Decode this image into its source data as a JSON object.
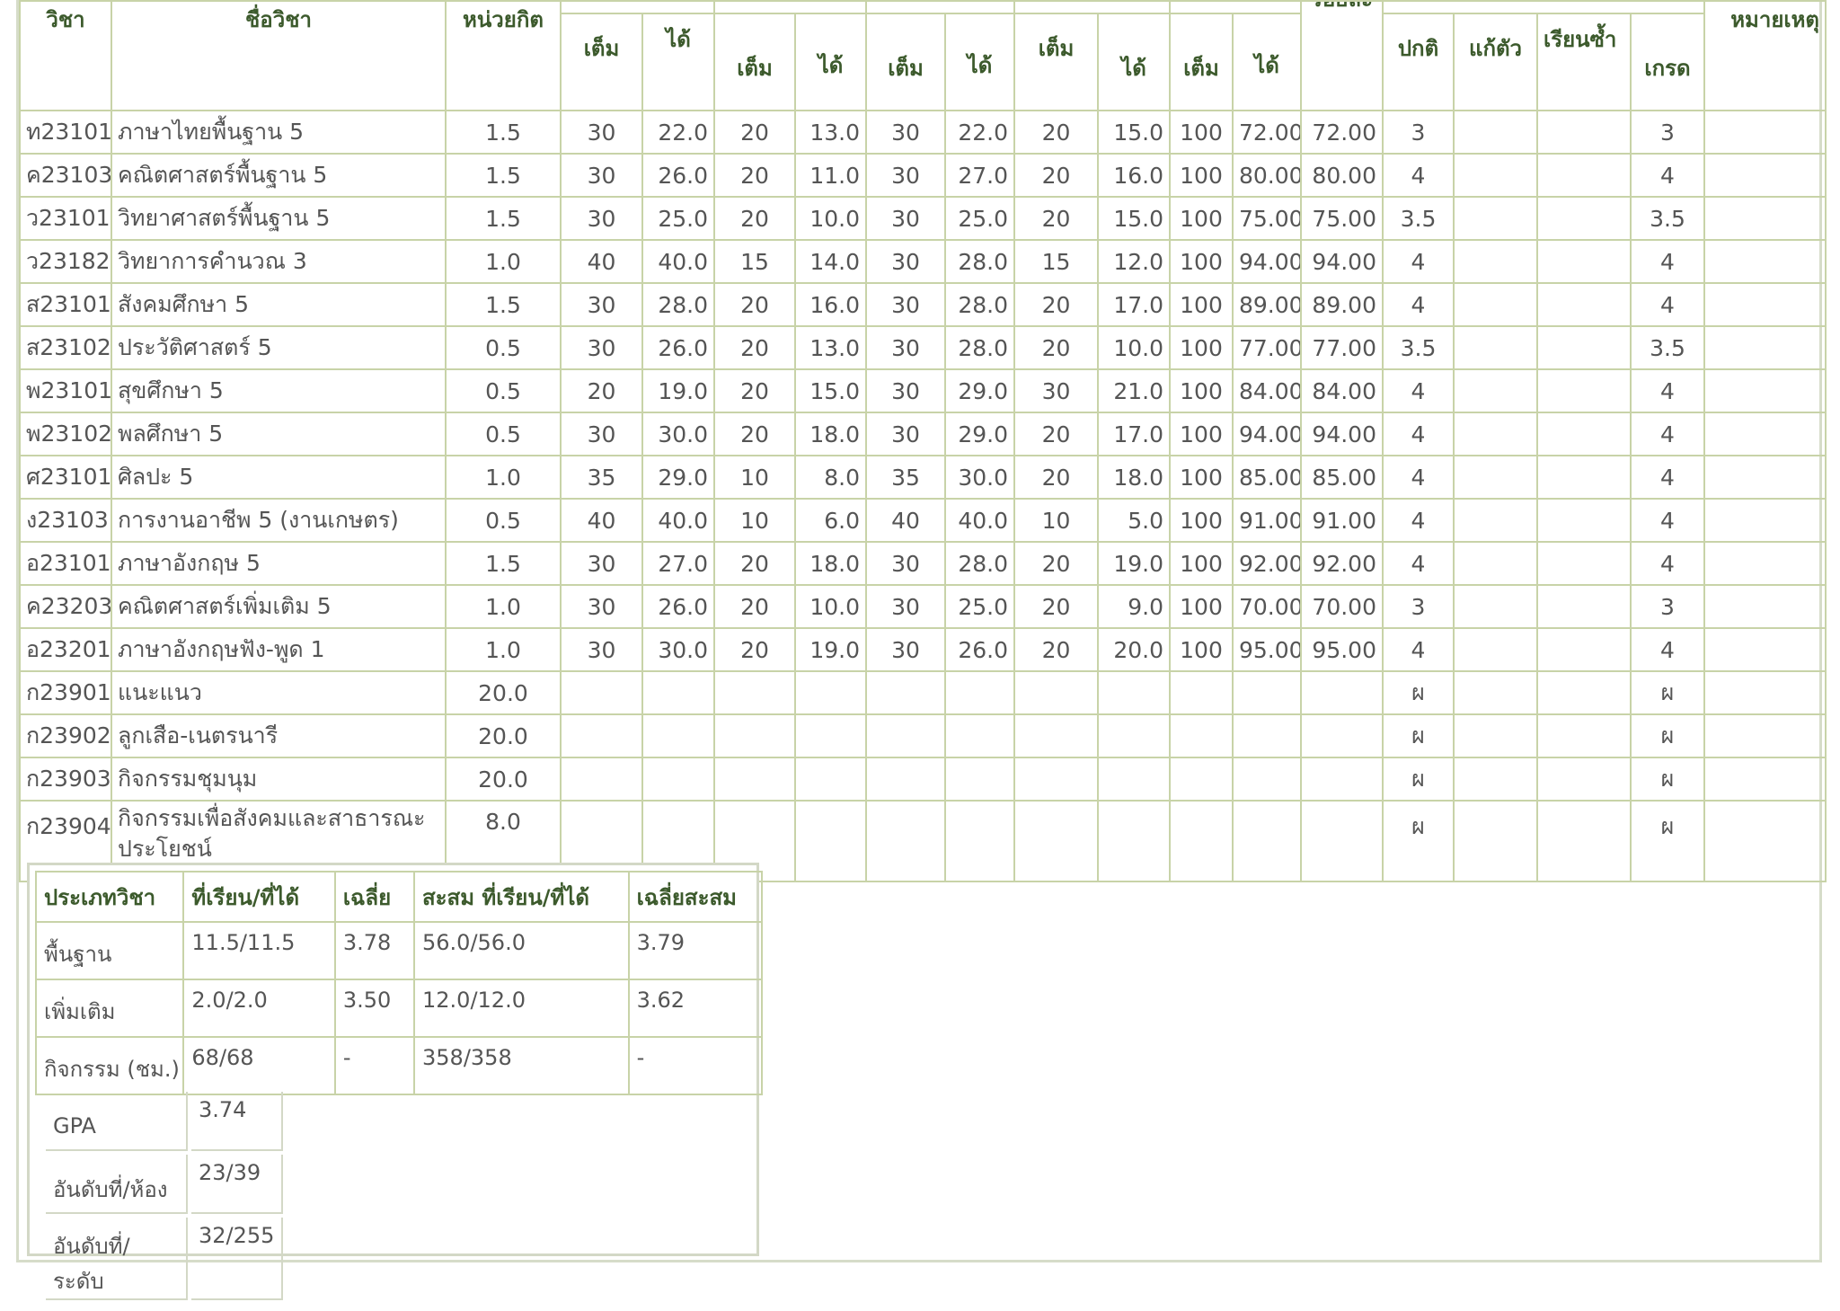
{
  "headers": {
    "code": "วิชา",
    "name": "ชื่อวิชา",
    "credit": "หน่วยกิต",
    "full": "เต็ม",
    "got": "ได้",
    "percent": "ร้อยละ",
    "normal": "ปกติ",
    "fix": "แก้ตัว",
    "repeat": "เรียนซ้ำ",
    "grade": "เกรด",
    "note": "หมายเหตุ"
  },
  "rows": [
    {
      "code": "ท23101",
      "name": "ภาษาไทยพื้นฐาน 5",
      "credit": "1.5",
      "s": [
        "30",
        "22.0",
        "20",
        "13.0",
        "30",
        "22.0",
        "20",
        "15.0",
        "100",
        "72.00"
      ],
      "percent": "72.00",
      "normal": "3",
      "grade": "3"
    },
    {
      "code": "ค23103",
      "name": "คณิตศาสตร์พื้นฐาน 5",
      "credit": "1.5",
      "s": [
        "30",
        "26.0",
        "20",
        "11.0",
        "30",
        "27.0",
        "20",
        "16.0",
        "100",
        "80.00"
      ],
      "percent": "80.00",
      "normal": "4",
      "grade": "4"
    },
    {
      "code": "ว23101",
      "name": "วิทยาศาสตร์พื้นฐาน 5",
      "credit": "1.5",
      "s": [
        "30",
        "25.0",
        "20",
        "10.0",
        "30",
        "25.0",
        "20",
        "15.0",
        "100",
        "75.00"
      ],
      "percent": "75.00",
      "normal": "3.5",
      "grade": "3.5"
    },
    {
      "code": "ว23182",
      "name": "วิทยาการคำนวณ 3",
      "credit": "1.0",
      "s": [
        "40",
        "40.0",
        "15",
        "14.0",
        "30",
        "28.0",
        "15",
        "12.0",
        "100",
        "94.00"
      ],
      "percent": "94.00",
      "normal": "4",
      "grade": "4"
    },
    {
      "code": "ส23101",
      "name": "สังคมศึกษา 5",
      "credit": "1.5",
      "s": [
        "30",
        "28.0",
        "20",
        "16.0",
        "30",
        "28.0",
        "20",
        "17.0",
        "100",
        "89.00"
      ],
      "percent": "89.00",
      "normal": "4",
      "grade": "4"
    },
    {
      "code": "ส23102",
      "name": "ประวัติศาสตร์ 5",
      "credit": "0.5",
      "s": [
        "30",
        "26.0",
        "20",
        "13.0",
        "30",
        "28.0",
        "20",
        "10.0",
        "100",
        "77.00"
      ],
      "percent": "77.00",
      "normal": "3.5",
      "grade": "3.5"
    },
    {
      "code": "พ23101",
      "name": "สุขศึกษา 5",
      "credit": "0.5",
      "s": [
        "20",
        "19.0",
        "20",
        "15.0",
        "30",
        "29.0",
        "30",
        "21.0",
        "100",
        "84.00"
      ],
      "percent": "84.00",
      "normal": "4",
      "grade": "4"
    },
    {
      "code": "พ23102",
      "name": "พลศึกษา 5",
      "credit": "0.5",
      "s": [
        "30",
        "30.0",
        "20",
        "18.0",
        "30",
        "29.0",
        "20",
        "17.0",
        "100",
        "94.00"
      ],
      "percent": "94.00",
      "normal": "4",
      "grade": "4"
    },
    {
      "code": "ศ23101",
      "name": "ศิลปะ 5",
      "credit": "1.0",
      "s": [
        "35",
        "29.0",
        "10",
        "8.0",
        "35",
        "30.0",
        "20",
        "18.0",
        "100",
        "85.00"
      ],
      "percent": "85.00",
      "normal": "4",
      "grade": "4"
    },
    {
      "code": "ง23103",
      "name": "การงานอาชีพ 5 (งานเกษตร)",
      "credit": "0.5",
      "s": [
        "40",
        "40.0",
        "10",
        "6.0",
        "40",
        "40.0",
        "10",
        "5.0",
        "100",
        "91.00"
      ],
      "percent": "91.00",
      "normal": "4",
      "grade": "4"
    },
    {
      "code": "อ23101",
      "name": "ภาษาอังกฤษ 5",
      "credit": "1.5",
      "s": [
        "30",
        "27.0",
        "20",
        "18.0",
        "30",
        "28.0",
        "20",
        "19.0",
        "100",
        "92.00"
      ],
      "percent": "92.00",
      "normal": "4",
      "grade": "4"
    },
    {
      "code": "ค23203",
      "name": "คณิตศาสตร์เพิ่มเติม 5",
      "credit": "1.0",
      "s": [
        "30",
        "26.0",
        "20",
        "10.0",
        "30",
        "25.0",
        "20",
        "9.0",
        "100",
        "70.00"
      ],
      "percent": "70.00",
      "normal": "3",
      "grade": "3"
    },
    {
      "code": "อ23201",
      "name": "ภาษาอังกฤษฟัง-พูด 1",
      "credit": "1.0",
      "s": [
        "30",
        "30.0",
        "20",
        "19.0",
        "30",
        "26.0",
        "20",
        "20.0",
        "100",
        "95.00"
      ],
      "percent": "95.00",
      "normal": "4",
      "grade": "4"
    },
    {
      "code": "ก23901",
      "name": "แนะแนว",
      "credit": "20.0",
      "s": [
        "",
        "",
        "",
        "",
        "",
        "",
        "",
        "",
        "",
        ""
      ],
      "percent": "",
      "normal": "ผ",
      "grade": "ผ"
    },
    {
      "code": "ก23902",
      "name": "ลูกเสือ-เนตรนารี",
      "credit": "20.0",
      "s": [
        "",
        "",
        "",
        "",
        "",
        "",
        "",
        "",
        "",
        ""
      ],
      "percent": "",
      "normal": "ผ",
      "grade": "ผ"
    },
    {
      "code": "ก23903",
      "name": "กิจกรรมชุมนุม",
      "credit": "20.0",
      "s": [
        "",
        "",
        "",
        "",
        "",
        "",
        "",
        "",
        "",
        ""
      ],
      "percent": "",
      "normal": "ผ",
      "grade": "ผ"
    },
    {
      "code": "ก23904",
      "name": "กิจกรรมเพื่อสังคมและสาธารณะประโยชน์",
      "credit": "8.0",
      "s": [
        "",
        "",
        "",
        "",
        "",
        "",
        "",
        "",
        "",
        ""
      ],
      "percent": "",
      "normal": "ผ",
      "grade": "ผ"
    }
  ],
  "summary": {
    "headers": [
      "ประเภทวิชา",
      "ที่เรียน/ที่ได้",
      "เฉลี่ย",
      "สะสม ที่เรียน/ที่ได้",
      "เฉลี่ยสะสม"
    ],
    "rows": [
      [
        "พื้นฐาน",
        "11.5/11.5",
        "3.78",
        "56.0/56.0",
        "3.79"
      ],
      [
        "เพิ่มเติม",
        "2.0/2.0",
        "3.50",
        "12.0/12.0",
        "3.62"
      ],
      [
        "กิจกรรม (ชม.)",
        "68/68",
        "-",
        "358/358",
        "-"
      ]
    ]
  },
  "stats": [
    {
      "label": "GPA",
      "value": "3.74"
    },
    {
      "label": "อันดับที่/ห้อง",
      "value": "23/39"
    },
    {
      "label": "อันดับที่/ระดับ",
      "value": "32/255"
    }
  ]
}
